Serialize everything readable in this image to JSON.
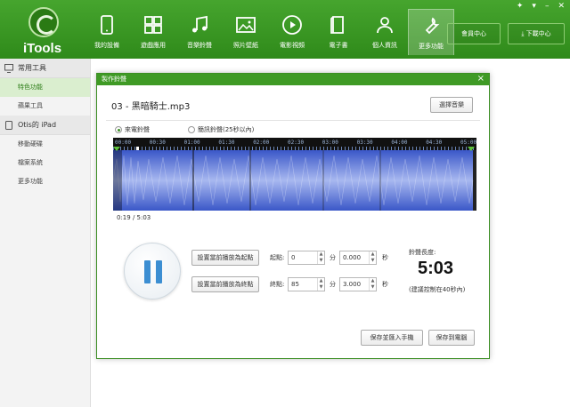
{
  "header": {
    "app_name": "iTools",
    "nav": [
      {
        "label": "我的設備",
        "icon": "device-icon"
      },
      {
        "label": "遊戲應用",
        "icon": "apps-icon"
      },
      {
        "label": "音樂鈴聲",
        "icon": "music-icon"
      },
      {
        "label": "照片壁紙",
        "icon": "photo-icon"
      },
      {
        "label": "電影視頻",
        "icon": "video-icon"
      },
      {
        "label": "電子書",
        "icon": "book-icon"
      },
      {
        "label": "個人資訊",
        "icon": "person-icon"
      },
      {
        "label": "更多功能",
        "icon": "tools-icon",
        "active": true
      }
    ],
    "member_center": "會員中心",
    "download_center": "下載中心"
  },
  "sidebar": {
    "groups": [
      {
        "title": "常用工具",
        "items": [
          "特色功能",
          "蘋果工具"
        ]
      },
      {
        "title": "Otis的 iPad",
        "items": [
          "移動硬碟",
          "檔案系統",
          "更多功能"
        ]
      }
    ],
    "active_item": "特色功能"
  },
  "dialog": {
    "title": "製作鈴聲",
    "close": "×",
    "song": "03 - 黑暗騎士.mp3",
    "select_music": "選擇音樂",
    "radio_incoming": "來電鈴聲",
    "radio_sms": "簡訊鈴聲(25秒以內)",
    "timeline_ticks": [
      "00:00",
      "00:30",
      "01:00",
      "01:30",
      "02:00",
      "02:30",
      "03:00",
      "03:30",
      "04:00",
      "04:30",
      "05:00"
    ],
    "position": "0:19 / 5:03",
    "set_start_btn": "設置當前播放為起點",
    "set_end_btn": "設置當前播放為終點",
    "start_label": "起點:",
    "end_label": "終點:",
    "start_min": "0",
    "start_sec": "0.000",
    "end_min": "85",
    "end_sec": "3.000",
    "min_unit": "分",
    "sec_unit": "秒",
    "length_label": "鈴聲長度:",
    "length_value": "5:03",
    "length_note": "(建議控制在40秒內)",
    "save_device": "保存並匯入手機",
    "save_pc": "保存到電腦"
  },
  "colors": {
    "brand_green": "#3f9a25",
    "wave_blue": "#3a57c8",
    "pause_blue": "#3c8ed2"
  }
}
